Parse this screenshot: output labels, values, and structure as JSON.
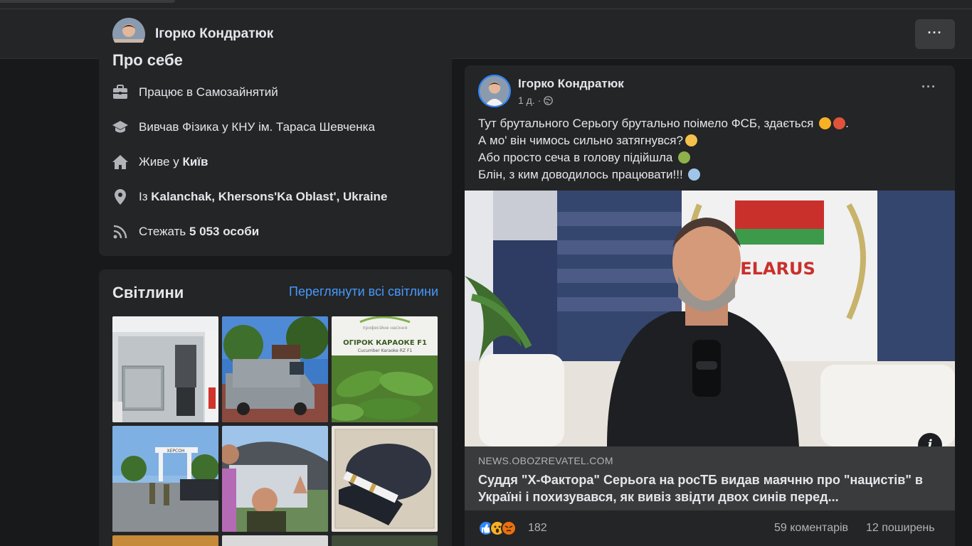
{
  "header": {
    "name": "Ігорко Кондратюк",
    "more_label": "···"
  },
  "about": {
    "title": "Про себе",
    "rows": [
      {
        "icon": "briefcase-icon",
        "text": "Працює в Самозайнятий"
      },
      {
        "icon": "graduation-cap-icon",
        "text": "Вивчав Фізика у КНУ ім. Тараса Шевченка"
      },
      {
        "icon": "home-icon",
        "prefix": "Живе у ",
        "bold": "Київ"
      },
      {
        "icon": "location-pin-icon",
        "prefix": "Із ",
        "bold": "Kalanchak, Khersons'Ka Oblast', Ukraine"
      },
      {
        "icon": "rss-icon",
        "prefix": "Стежать ",
        "bold": "5 053 особи"
      }
    ]
  },
  "photos": {
    "title": "Світлини",
    "see_all": "Переглянути всі світлини",
    "packet_title": "ОГІРОК КАРАОКЕ F1",
    "packet_sub": "Cucumber Karaoke RZ F1",
    "packet_brand": "професійне насіння",
    "sign_text": "ХЕРСОН"
  },
  "post": {
    "author": "Ігорко Кондратюк",
    "time": "1 д.",
    "separator": "·",
    "more_label": "···",
    "lines": [
      "Тут брутального Серьогу брутально поімело ФСБ, здається",
      "А мо' він чимось сильно затягнувся?",
      "Або просто сеча в голову підійшла",
      "Блін, з ким доводилось працювати!!!"
    ],
    "line1_end": ".",
    "image_sign": "ELARUS",
    "link": {
      "domain": "NEWS.OBOZREVATEL.COM",
      "headline": "Суддя \"Х-Фактора\" Серьога на росТБ видав маячню про \"нацистів\" в Україні і похизувався, як вивіз звідти двох синів перед..."
    },
    "info_label": "i",
    "reactions_count": "182",
    "comments": "59 коментарів",
    "shares": "12 поширень"
  },
  "colors": {
    "background": "#18191a",
    "card": "#242526",
    "accent_link": "#4599ff",
    "like": "#2d88ff",
    "haha": "#f7b125",
    "angry": "#e9710f"
  }
}
